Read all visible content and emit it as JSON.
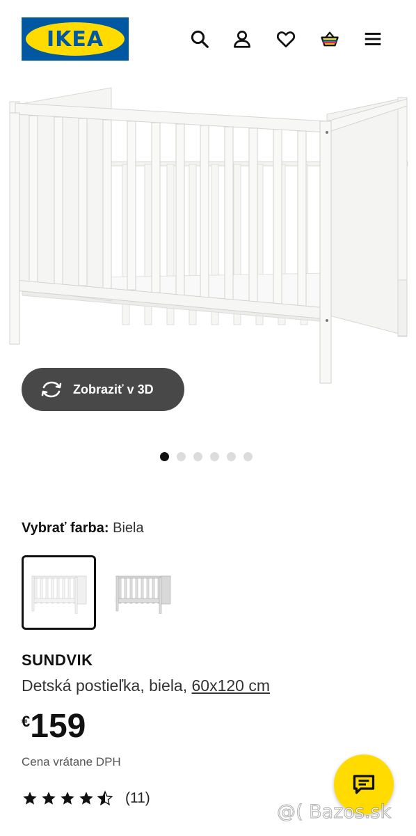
{
  "header": {
    "logo_text": "IKEA",
    "icons": [
      "search-icon",
      "user-icon",
      "heart-icon",
      "basket-icon",
      "menu-icon"
    ]
  },
  "gallery": {
    "view_3d_label": "Zobraziť v 3D",
    "dots_total": 6,
    "dots_active": 1
  },
  "color_select": {
    "label": "Vybrať farba:",
    "value": "Biela"
  },
  "product": {
    "name": "SUNDVIK",
    "description": "Detská postieľka, biela,",
    "size": "60x120 cm",
    "currency": "€",
    "price": "159",
    "vat_note": "Cena vrátane DPH",
    "rating_stars": 4.5,
    "rating_count": "(11)"
  },
  "watermark": "@( Bazos.sk",
  "colors": {
    "ikea_blue": "#0058a3",
    "ikea_yellow": "#ffdb00",
    "button_dark": "#484848"
  }
}
